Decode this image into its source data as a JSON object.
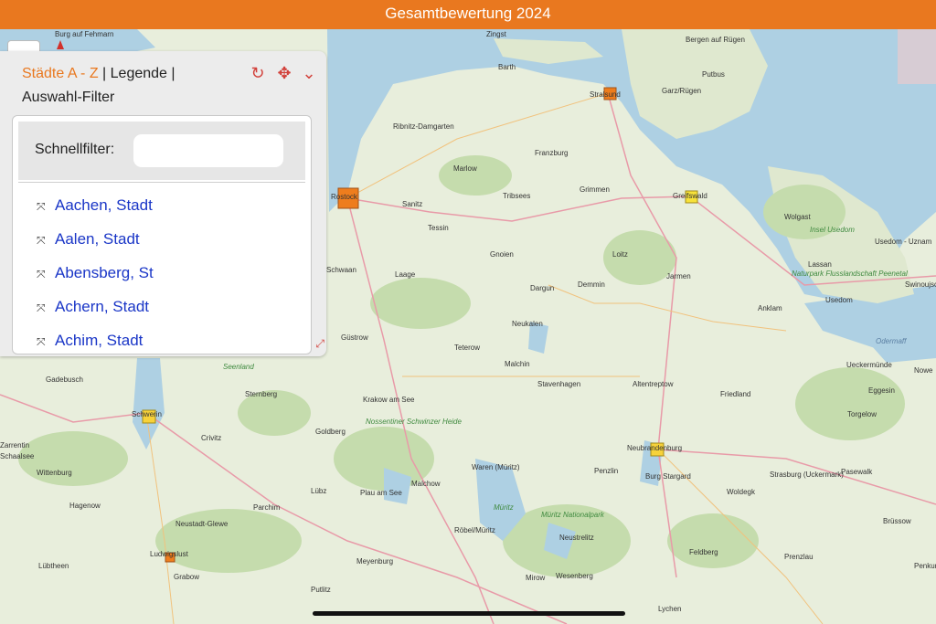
{
  "app": {
    "title": "Gesamtbewertung 2024"
  },
  "panel": {
    "tab_active": "Städte A - Z",
    "tab_sep1": " | ",
    "tab_legend": "Legende",
    "tab_sep2": " |",
    "tab_filter": "Auswahl-Filter",
    "filter_label": "Schnellfilter:",
    "filter_value": "",
    "items": [
      {
        "label": "Aachen, Stadt"
      },
      {
        "label": "Aalen, Stadt"
      },
      {
        "label": "Abensberg, St"
      },
      {
        "label": "Achern, Stadt"
      },
      {
        "label": "Achim, Stadt"
      }
    ]
  },
  "map": {
    "towns": [
      "Burg auf Fehmarn",
      "Zingst",
      "Bergen auf Rügen",
      "Barth",
      "Putbus",
      "Stralsund",
      "Garz/Rügen",
      "Ribnitz-Damgarten",
      "Franzburg",
      "Marlow",
      "Rostock",
      "Tribsees",
      "Grimmen",
      "Greifswald",
      "Wolgast",
      "Sanitz",
      "Tessin",
      "Usedom - Uznam",
      "Gnoien",
      "Loitz",
      "Lassan",
      "Jarmen",
      "Usedom",
      "Laage",
      "Dargun",
      "Demmin",
      "Anklam",
      "Schwaan",
      "Neukalen",
      "Güstrow",
      "Teterow",
      "Gadebusch",
      "Sternberg",
      "Malchin",
      "Ueckermünde",
      "Stavenhagen",
      "Altentreptow",
      "Eggesin",
      "Krakow am See",
      "Friedland",
      "Schwerin",
      "Torgelow",
      "Crivitz",
      "Goldberg",
      "Neubrandenburg",
      "Zarrentin",
      "Schaalsee",
      "Wittenburg",
      "Burg Stargard",
      "Pasewalk",
      "Penzlin",
      "Strasburg (Uckermark)",
      "Waren (Müritz)",
      "Malchow",
      "Lübz",
      "Plau am See",
      "Woldegk",
      "Hagenow",
      "Parchim",
      "Neustadt-Glewe",
      "Brüssow",
      "Röbel/Müritz",
      "Neustrelitz",
      "Ludwigslust",
      "Feldberg",
      "Prenzlau",
      "Lübtheen",
      "Grabow",
      "Meyenburg",
      "Wesenberg",
      "Putlitz",
      "Mirow",
      "Lychen",
      "Swinoujscie",
      "Nowe",
      "Penkun"
    ],
    "areas": [
      "Insel Usedom",
      "Naturpark Flusslandschaft Peenetal",
      "Seenland",
      "Nossentiner Schwinzer Heide",
      "Müritz",
      "Müritz Nationalpark",
      "Odermaff"
    ],
    "colors": {
      "orange": "#ee7d1d",
      "yellow": "#f7d23a",
      "accent": "#e9781f",
      "link": "#1a36c7"
    }
  }
}
